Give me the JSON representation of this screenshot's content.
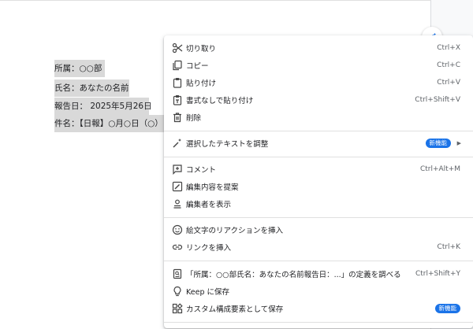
{
  "document": {
    "lines": [
      "所属：○○部",
      "氏名：あなたの名前",
      "報告日： 2025年5月26日",
      "件名：【日報】○月○日（○）"
    ]
  },
  "menu": {
    "cut": {
      "label": "切り取り",
      "shortcut": "Ctrl+X"
    },
    "copy": {
      "label": "コピー",
      "shortcut": "Ctrl+C"
    },
    "paste": {
      "label": "貼り付け",
      "shortcut": "Ctrl+V"
    },
    "paste_plain": {
      "label": "書式なしで貼り付け",
      "shortcut": "Ctrl+Shift+V"
    },
    "delete": {
      "label": "削除"
    },
    "adjust": {
      "label": "選択したテキストを調整",
      "badge": "新機能"
    },
    "comment": {
      "label": "コメント",
      "shortcut": "Ctrl+Alt+M"
    },
    "suggest": {
      "label": "編集内容を提案"
    },
    "editors": {
      "label": "編集者を表示"
    },
    "emoji": {
      "label": "絵文字のリアクションを挿入"
    },
    "link": {
      "label": "リンクを挿入",
      "shortcut": "Ctrl+K"
    },
    "define": {
      "label": "「所属：○○部氏名：あなたの名前報告日：...」の定義を調べる",
      "shortcut": "Ctrl+Shift+Y"
    },
    "keep": {
      "label": "Keep に保存"
    },
    "custom": {
      "label": "カスタム構成要素として保存",
      "badge": "新機能"
    }
  },
  "colors": {
    "accent": "#1a73e8",
    "selection": "#d9d9d9"
  }
}
